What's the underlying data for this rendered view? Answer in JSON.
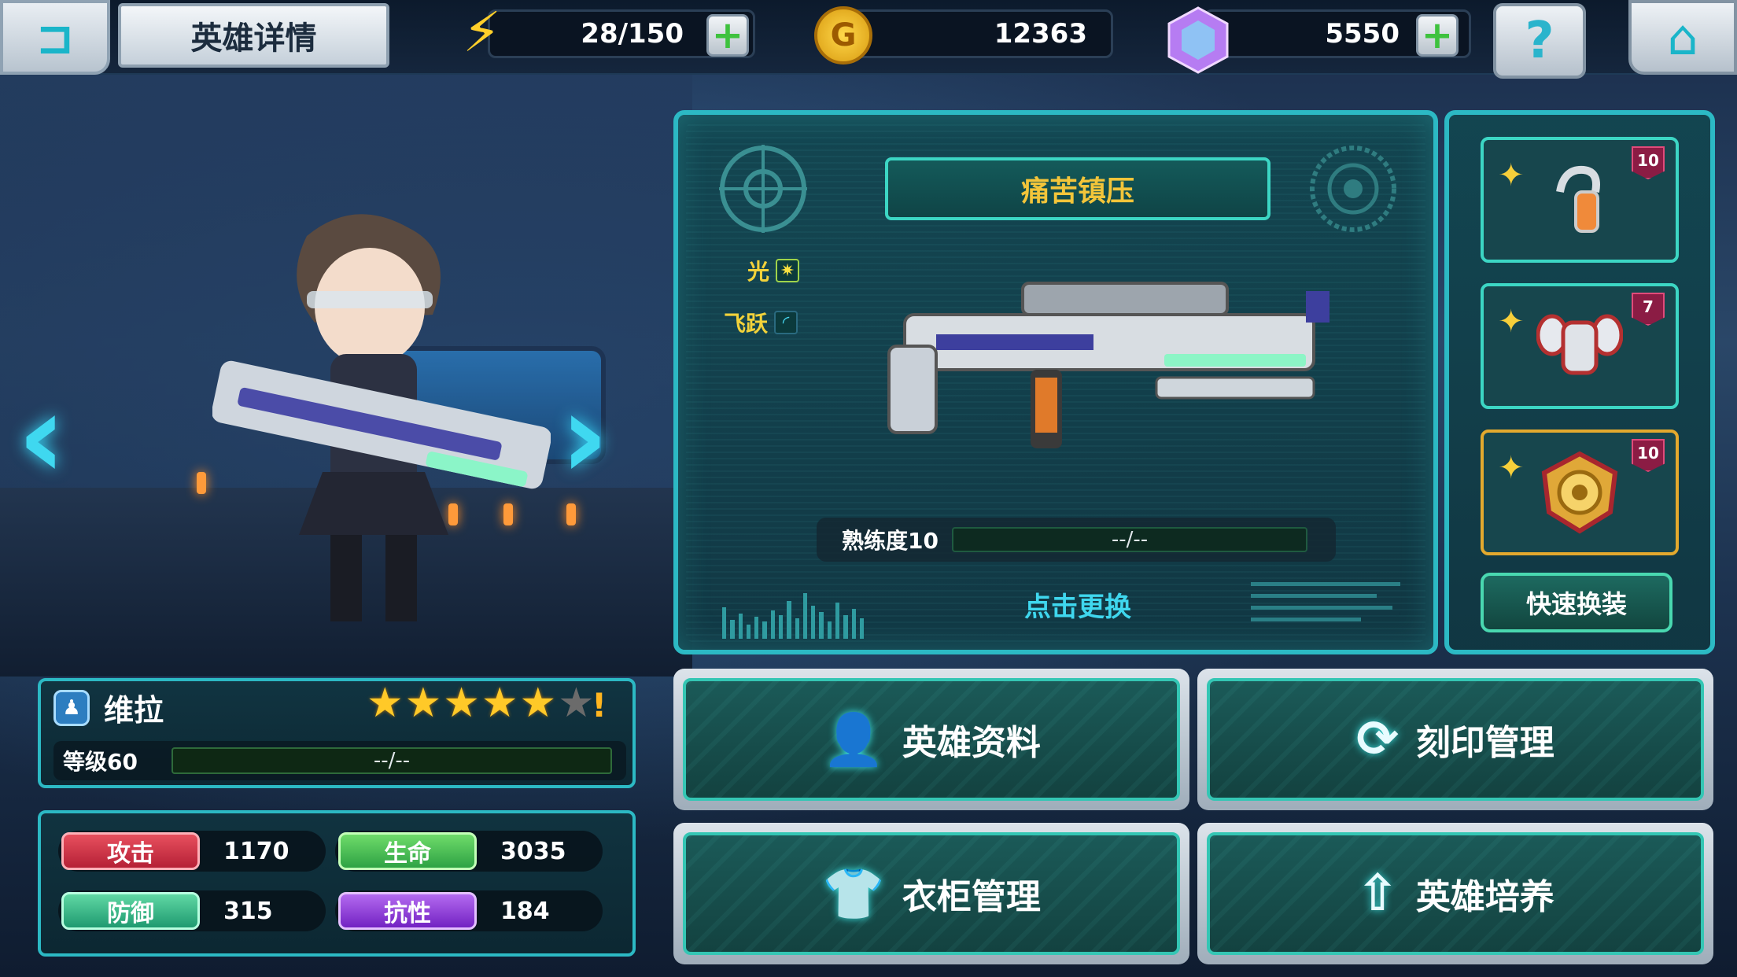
{
  "header": {
    "title": "英雄详情",
    "energy": "28/150",
    "gold": "12363",
    "gems": "5550"
  },
  "icons": {
    "back": "back-arrow-icon",
    "energy": "lightning-icon",
    "gold": "gold-coin-icon",
    "gem": "gem-icon",
    "help": "question-icon",
    "home": "home-icon"
  },
  "weapon": {
    "name": "痛苦镇压",
    "attributes": [
      {
        "label": "光"
      },
      {
        "label": "飞跃"
      }
    ],
    "mastery_label": "熟练度10",
    "mastery_value": "--/--",
    "replace_label": "点击更换"
  },
  "equipment": {
    "slots": [
      {
        "icon": "headset-icon",
        "level": "10"
      },
      {
        "icon": "armor-icon",
        "level": "7"
      },
      {
        "icon": "medal-icon",
        "level": "10"
      }
    ],
    "quick_label": "快速换装"
  },
  "hero": {
    "name": "维拉",
    "stars_filled": 5,
    "stars_total": 6,
    "level_label": "等级60",
    "exp_value": "--/--",
    "stats": {
      "attack_label": "攻击",
      "attack_value": "1170",
      "hp_label": "生命",
      "hp_value": "3035",
      "defense_label": "防御",
      "defense_value": "315",
      "resist_label": "抗性",
      "resist_value": "184"
    }
  },
  "menu": {
    "hero_info": "英雄资料",
    "imprint": "刻印管理",
    "wardrobe": "衣柜管理",
    "training": "英雄培养"
  },
  "colors": {
    "accent": "#2cb9c4",
    "gold_text": "#f3c53a",
    "cyan_text": "#3fd7ee"
  }
}
